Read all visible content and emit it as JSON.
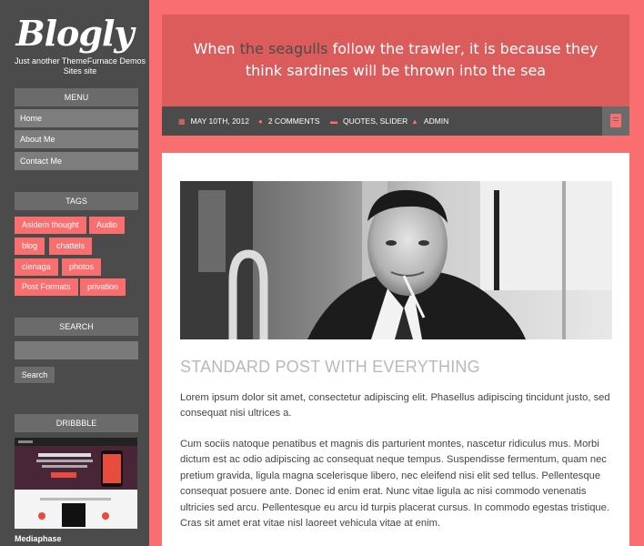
{
  "site": {
    "logo": "Blogly",
    "tagline": "Just another ThemeFurnace Demos Sites site"
  },
  "sidebar": {
    "menu_title": "MENU",
    "menu": [
      "Home",
      "About Me",
      "Contact Me"
    ],
    "tags_title": "TAGS",
    "tags": [
      "Asidem thought",
      "Audio",
      "blog",
      "chattels",
      "cienaga",
      "photos",
      "Post Formats",
      "privation"
    ],
    "search_title": "SEARCH",
    "search_button": "Search",
    "dribbble_title": "DRIBBBLE",
    "dribbble_caption": "Mediaphase"
  },
  "quote": {
    "before": "When ",
    "highlight": "the seagulls",
    "after": " follow the trawler, it is because they think sardines will be thrown into the sea"
  },
  "meta": {
    "date": "MAY 10TH, 2012",
    "comments": "2 COMMENTS",
    "categories": "QUOTES, SLIDER",
    "author": "ADMIN"
  },
  "post": {
    "title": "STANDARD POST WITH EVERYTHING",
    "paragraphs": [
      "Lorem ipsum dolor sit amet, consectetur adipiscing elit. Phasellus adipiscing tincidunt justo, sed consequat nisi ultrices a.",
      "Cum sociis natoque penatibus et magnis dis parturient montes, nascetur ridiculus mus. Morbi dictum est ac odio adipiscing ac consequat neque tempus. Suspendisse fermentum, quam nec pretium gravida, ligula magna scelerisque libero, nec eleifend nisi elit sed tellus. Pellentesque consequat posuere ante. Donec id enim erat. Nunc vitae ligula ac nisi commodo venenatis ultricies sed arcu. Pellentesque eu arcu id turpis placerat cursus. In commodo egestas tristique. Cras sit amet erat vitae nisl laoreet vehicula vitae at enim."
    ]
  },
  "colors": {
    "accent": "#f96f6f",
    "quote_bg": "#dc5c5c",
    "sidebar_bg": "#4b4b4b"
  },
  "icons": {
    "date": "calendar-icon",
    "comments": "comment-icon",
    "categories": "folder-icon",
    "author": "user-icon",
    "format": "book-icon"
  }
}
